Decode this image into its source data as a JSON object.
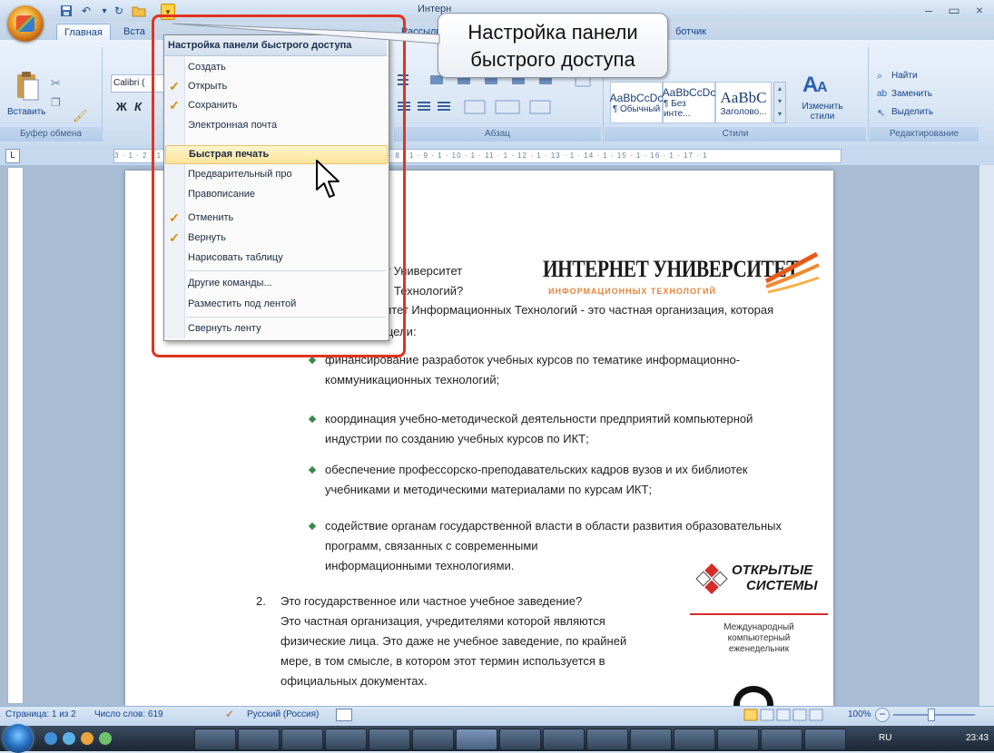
{
  "window": {
    "title_partial": "Интерн",
    "controls": [
      "–",
      "▭",
      "×"
    ]
  },
  "qat": {
    "icons": [
      "save-icon",
      "undo-icon",
      "redo-icon",
      "open-icon"
    ],
    "customize_glyph": "▾"
  },
  "tabs": [
    {
      "label": "Главная",
      "active": true
    },
    {
      "label": "Вста"
    },
    {
      "label": "Рассылк"
    },
    {
      "label": "ботчик"
    }
  ],
  "ribbon": {
    "paste_label": "Вставить",
    "font_name": "Calibri (",
    "bold": "Ж",
    "italic": "К",
    "groups": {
      "clipboard": "Буфер обмена",
      "paragraph": "Абзац",
      "styles": "Стили",
      "editing": "Редактирование"
    },
    "styles": [
      {
        "preview": "AaBbCcDc",
        "name": "¶ Обычный"
      },
      {
        "preview": "AaBbCcDc",
        "name": "¶ Без инте..."
      },
      {
        "preview": "AaBbC",
        "name": "Заголово..."
      }
    ],
    "change_styles": "Изменить стили",
    "edit": {
      "find": "Найти",
      "replace": "Заменить",
      "select": "Выделить"
    }
  },
  "ruler_text": "3 · 1 · 2 · 1 · 1 · 1 · · · 1 · 2 · 1 · 3 · 1 · 4 · 1 · 5 · 1 · 6 · 1 · 7 · 1 · 8 · 1 · 9 · 1 · 10 · 1 · 11 · 1 · 12 · 1 · 13 · 1 · 14 · 1 · 15 · 1 · 16 · 1 · 17 · 1",
  "menu": {
    "header": "Настройка панели быстрого доступа",
    "items": [
      {
        "label": "Создать",
        "checked": false
      },
      {
        "label": "Открыть",
        "checked": true
      },
      {
        "label": "Сохранить",
        "checked": true
      },
      {
        "label": "Электронная почта",
        "checked": false
      },
      {
        "label": "Быстрая печать",
        "checked": false,
        "hover": true
      },
      {
        "label": "Предварительный про",
        "checked": false
      },
      {
        "label": "Правописание",
        "checked": false
      },
      {
        "label": "Отменить",
        "checked": true
      },
      {
        "label": "Вернуть",
        "checked": true
      },
      {
        "label": "Нарисовать таблицу",
        "checked": false
      },
      {
        "label": "Другие команды...",
        "checked": false
      },
      {
        "label": "Разместить под лентой",
        "checked": false
      },
      {
        "label": "Свернуть ленту",
        "checked": false
      }
    ]
  },
  "callout": {
    "line1": "Настройка панели",
    "line2": "быстрого доступа"
  },
  "document": {
    "frag1": "т Университет",
    "frag2": "Технологий?",
    "frag3": "итет Информационных Технологий - это частная организация, которая",
    "frag4": "цели:",
    "bullets": [
      [
        "финансирование разработок учебных курсов по тематике информационно-",
        "коммуникационных технологий;"
      ],
      [
        "координация учебно-методической деятельности предприятий компьютерной",
        "индустрии по созданию учебных курсов по ИКТ;"
      ],
      [
        "обеспечение профессорско-преподавательских кадров вузов и их библиотек",
        "учебниками и методическими материалами по курсам ИКТ;"
      ],
      [
        "содействие органам государственной власти в области развития образовательных",
        "программ, связанных с современными",
        "информационными технологиями."
      ]
    ],
    "item2_num": "2.",
    "item2_lines": [
      "Это государственное или частное учебное заведение?",
      "Это частная организация, учредителями которой являются",
      "физические лица. Это даже не учебное заведение, по крайней",
      "мере, в том смысле, в котором этот термин используется в",
      "официальных документах."
    ],
    "logo1_title": "ИНТЕРНЕТ УНИВЕРСИТЕТ",
    "logo1_sub": "ИНФОРМАЦИОННЫХ ТЕХНОЛОГИЙ",
    "logo2_line1": "ОТКРЫТЫЕ",
    "logo2_line2": "СИСТЕМЫ",
    "logo2_caption": [
      "Международный",
      "компьютерный",
      "еженедельник"
    ]
  },
  "status": {
    "page": "Страница: 1 из 2",
    "words": "Число слов: 619",
    "lang": "Русский (Россия)",
    "zoom": "100%"
  },
  "taskbar": {
    "lang": "RU",
    "time": "23:43"
  },
  "colors": {
    "red_frame": "#e2331f",
    "menu_hover": "#ffe49a",
    "check": "#d88a00"
  }
}
